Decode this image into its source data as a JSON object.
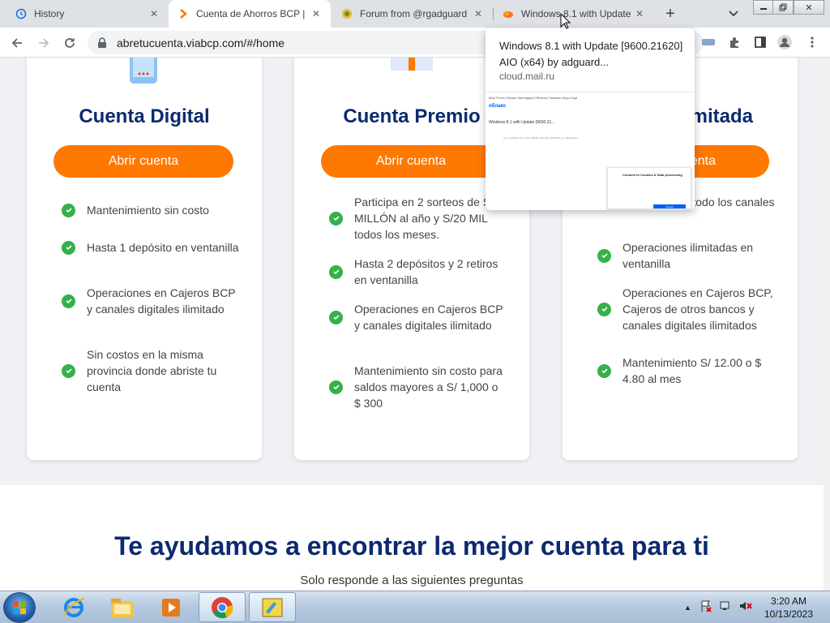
{
  "browser": {
    "tabs": [
      {
        "title": "History",
        "icon": "history-icon",
        "active": false
      },
      {
        "title": "Cuenta de Ahorros BCP |",
        "icon": "bcp-chevron-icon",
        "active": true
      },
      {
        "title": "Forum from @rgadguard",
        "icon": "forum-favicon-icon",
        "active": false
      },
      {
        "title": "Windows 8.1 with Update",
        "icon": "cloud-mail-icon",
        "active": false
      }
    ],
    "new_tab_label": "+",
    "url": "abretucuenta.viabcp.com/#/home"
  },
  "hover_card": {
    "title": "Windows 8.1 with Update [9600.21620] AIO (x64) by adguard...",
    "domain": "cloud.mail.ru",
    "thumb_nav": "Mail   Почта   Облако   Календарь   Облачно   Заметки   Игры   Ещё",
    "thumb_logo": "облако",
    "thumb_file": "Windows 8.1 with Update [9600.21...",
    "thumb_row": "ru-ru_windows_8.1_with_update_x64_dvd_6051480_by_adguard.iso",
    "thumb_consent_title": "Consent to Cookies & Data processing",
    "thumb_btn_accept": "Accept"
  },
  "cards": [
    {
      "title": "Cuenta Digital",
      "button": "Abrir cuenta",
      "features": [
        "Mantenimiento sin costo",
        "Hasta 1 depósito en ventanilla",
        "Operaciones en Cajeros BCP y canales digitales ilimitado",
        "Sin costos en la misma provincia donde abriste tu cuenta"
      ]
    },
    {
      "title": "Cuenta Premio",
      "button": "Abrir cuenta",
      "features": [
        "Participa en 2 sorteos de S/1 MILLÓN al año y S/20 MIL todos los meses.",
        "Hasta 2 depósitos y 2 retiros en ventanilla",
        "Operaciones en Cajeros BCP y canales digitales ilimitado",
        "Mantenimiento sin costo para saldos mayores a S/ 1,000 o $ 300"
      ]
    },
    {
      "title": "imitada",
      "button": "enta",
      "features": [
        "ilimitadas por todo los canales",
        "Operaciones ilimitadas en ventanilla",
        "Operaciones en Cajeros BCP, Cajeros de otros bancos y canales digitales ilimitados",
        "Mantenimiento S/ 12.00 o $ 4.80 al mes"
      ]
    }
  ],
  "help": {
    "title": "Te ayudamos a encontrar la mejor cuenta para ti",
    "subtitle": "Solo responde a las siguientes preguntas"
  },
  "taskbar": {
    "time": "3:20 AM",
    "date": "10/13/2023",
    "show_hidden_label": "▲"
  },
  "colors": {
    "brand_blue": "#0c2a6e",
    "brand_orange": "#ff7800",
    "check_green": "#35b14a"
  }
}
